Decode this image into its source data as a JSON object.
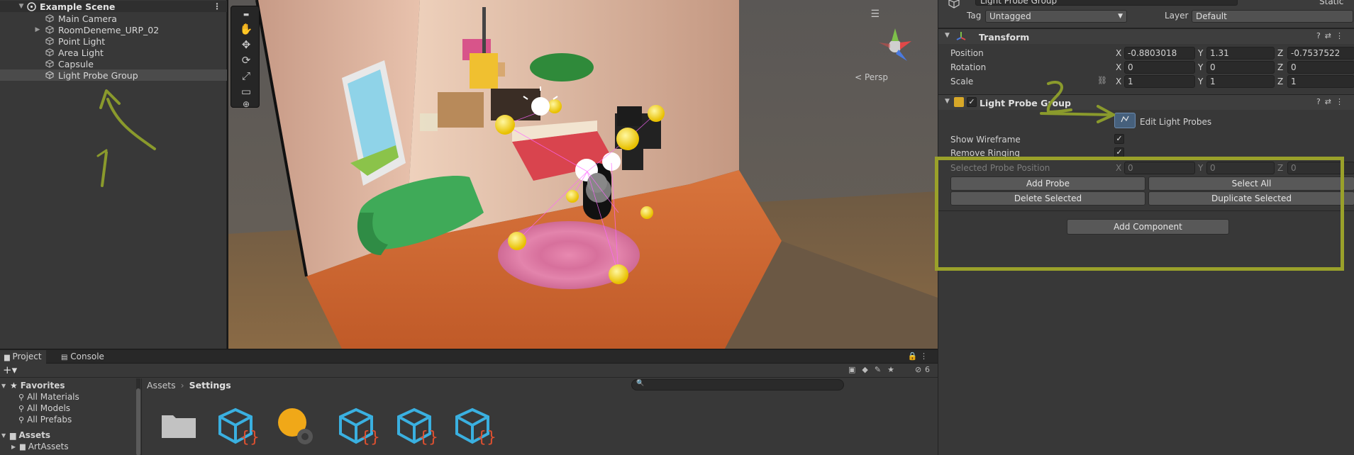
{
  "hierarchy": {
    "scene_name": "Example Scene",
    "items": [
      {
        "label": "Main Camera",
        "has_arrow": false
      },
      {
        "label": "RoomDeneme_URP_02",
        "has_arrow": true
      },
      {
        "label": "Point Light",
        "has_arrow": false
      },
      {
        "label": "Area Light",
        "has_arrow": false
      },
      {
        "label": "Capsule",
        "has_arrow": false
      },
      {
        "label": "Light Probe Group",
        "has_arrow": false,
        "selected": true
      }
    ],
    "annotation": "1"
  },
  "scene_view": {
    "persp_label": "< Persp",
    "tools": [
      "hand-tool",
      "move-tool",
      "rotate-tool",
      "scale-tool",
      "rect-tool",
      "transform-tool"
    ]
  },
  "inspector": {
    "object_name": "Light Probe Group",
    "static_label": "Static",
    "tag_label": "Tag",
    "tag_value": "Untagged",
    "layer_label": "Layer",
    "layer_value": "Default",
    "transform": {
      "title": "Transform",
      "position_label": "Position",
      "rotation_label": "Rotation",
      "scale_label": "Scale",
      "position": {
        "x": "-0.8803018",
        "y": "1.31",
        "z": "-0.7537522"
      },
      "rotation": {
        "x": "0",
        "y": "0",
        "z": "0"
      },
      "scale": {
        "x": "1",
        "y": "1",
        "z": "1"
      },
      "axis_x": "X",
      "axis_y": "Y",
      "axis_z": "Z"
    },
    "light_probe_group": {
      "title": "Light Probe Group",
      "edit_label": "Edit Light Probes",
      "show_wireframe_label": "Show Wireframe",
      "remove_ringing_label": "Remove Ringing",
      "selected_probe_label": "Selected Probe Position",
      "selected_probe": {
        "x": "0",
        "y": "0",
        "z": "0"
      },
      "add_probe": "Add Probe",
      "select_all": "Select All",
      "delete_selected": "Delete Selected",
      "duplicate_selected": "Duplicate Selected"
    },
    "add_component": "Add Component",
    "annotation": "2"
  },
  "project": {
    "tab_project": "Project",
    "tab_console": "Console",
    "favorites_label": "Favorites",
    "favorites": [
      "All Materials",
      "All Models",
      "All Prefabs"
    ],
    "assets_label": "Assets",
    "art_assets": "ArtAssets",
    "breadcrumb_root": "Assets",
    "breadcrumb_current": "Settings",
    "hidden_count": "6"
  },
  "colors": {
    "highlight_box": "#9aa12a",
    "annotation": "#8a9a2c"
  }
}
